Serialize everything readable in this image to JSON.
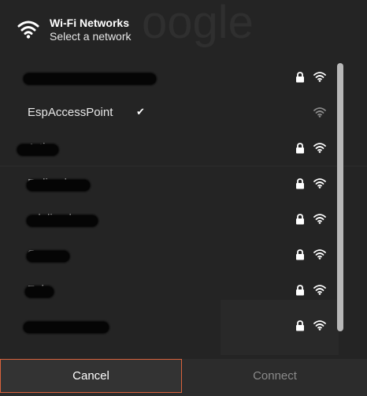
{
  "header": {
    "icon": "wifi-icon",
    "title": "Wi-Fi Networks",
    "subtitle": "Select a network"
  },
  "networks": [
    {
      "name": "",
      "redacted": true,
      "secured": true,
      "connected": false
    },
    {
      "name": "EspAccessPoint",
      "redacted": false,
      "secured": false,
      "connected": true
    },
    {
      "name": "Arti",
      "redacted": true,
      "secured": true,
      "connected": false
    },
    {
      "name": "Dalivada",
      "redacted": true,
      "secured": true,
      "connected": false
    },
    {
      "name": "adalivada",
      "redacted": true,
      "secured": true,
      "connected": false
    },
    {
      "name": "Sury",
      "redacted": true,
      "secured": true,
      "connected": false
    },
    {
      "name": "Zel",
      "redacted": true,
      "secured": true,
      "connected": false
    },
    {
      "name": "",
      "redacted": true,
      "secured": true,
      "connected": false
    }
  ],
  "footer": {
    "cancel_label": "Cancel",
    "connect_label": "Connect"
  },
  "colors": {
    "background": "#242424",
    "cancel_border": "#d9623c",
    "disabled_text": "#8a8a8a"
  }
}
